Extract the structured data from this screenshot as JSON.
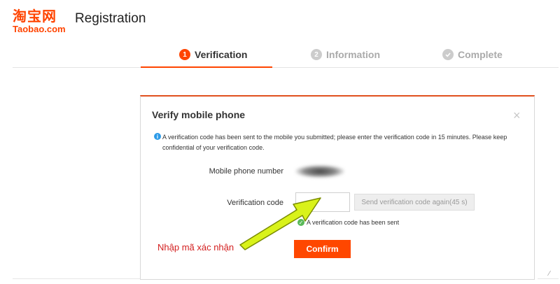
{
  "header": {
    "logo_cn": "淘宝网",
    "logo_en": "Taobao.com",
    "title": "Registration"
  },
  "steps": [
    {
      "number": "1",
      "label": "Verification",
      "state": "active"
    },
    {
      "number": "2",
      "label": "Information",
      "state": "inactive"
    },
    {
      "number": "",
      "label": "Complete",
      "state": "inactive"
    }
  ],
  "dialog": {
    "title": "Verify mobile phone",
    "close_icon": "×",
    "notice_icon": "i",
    "notice": "A verification code has been sent to the mobile you submitted; please enter the verification code in 15 minutes. Please keep confidential of your verification code.",
    "phone_label": "Mobile phone number",
    "code_label": "Verification code",
    "code_value": "",
    "send_again_label": "Send verification code again(45 s)",
    "sent_icon": "✓",
    "sent_message": "A verification code has been sent",
    "confirm_label": "Confirm"
  },
  "annotation": {
    "text": "Nhập mã xác nhận"
  },
  "colors": {
    "accent": "#ff4400",
    "confirm": "#ff4700",
    "info": "#2d9be8",
    "success": "#59b959",
    "annotation_text": "#d31e1e",
    "annotation_arrow": "#d9f21a"
  }
}
